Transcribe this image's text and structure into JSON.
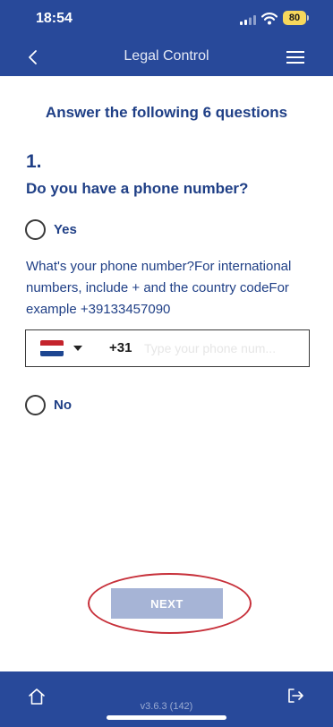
{
  "status_bar": {
    "time": "18:54",
    "battery": "80",
    "icons": [
      "signal-icon",
      "wifi-icon",
      "battery-icon"
    ]
  },
  "header": {
    "title": "Legal Control",
    "back_icon": "chevron-left-icon",
    "menu_icon": "hamburger-menu-icon"
  },
  "form": {
    "intro": "Answer the following 6 questions",
    "question": {
      "number": "1.",
      "text": "Do you have a phone number?",
      "options": [
        {
          "label": "Yes",
          "selected": false
        },
        {
          "label": "No",
          "selected": false
        }
      ],
      "phone": {
        "instructions": "What's your phone number?For international numbers, include + and the country codeFor example +39133457090",
        "country_flag": "netherlands-flag-icon",
        "dial_code": "+31",
        "value": "",
        "placeholder": "Type your phone num..."
      }
    },
    "next_label": "NEXT"
  },
  "footer": {
    "version": "v3.6.3 (142)",
    "home_icon": "home-icon",
    "logout_icon": "logout-icon"
  },
  "colors": {
    "brand": "#28499a",
    "text": "#1f3f86",
    "button_disabled": "#a6b4d6",
    "highlight": "#c7303a"
  }
}
